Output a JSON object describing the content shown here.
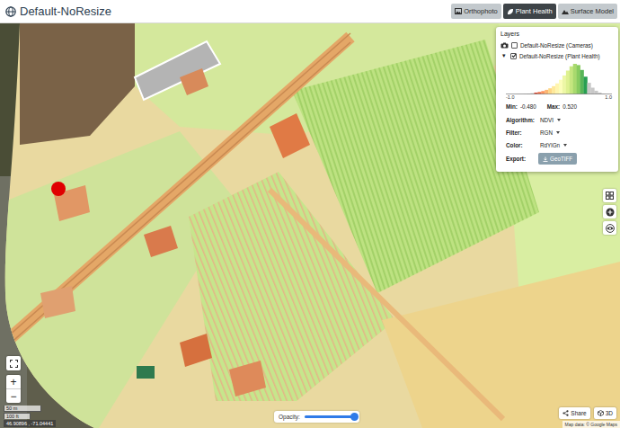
{
  "window": {
    "title": "Default-NoResize"
  },
  "view_tabs": [
    {
      "label": "Orthophoto",
      "selected": false,
      "kind": "image"
    },
    {
      "label": "Plant Health",
      "selected": true,
      "kind": "leaf"
    },
    {
      "label": "Surface Model",
      "selected": false,
      "kind": "terrain"
    }
  ],
  "layers_panel": {
    "title": "Layers",
    "layers": [
      {
        "kind": "cameras",
        "label": "Default-NoResize (Cameras)",
        "checked": false,
        "expanded": false
      },
      {
        "kind": "raster",
        "toggle": "▾",
        "label": "Default-NoResize (Plant Health)",
        "checked": true,
        "expanded": true,
        "details": {
          "histogram": {
            "axis_min": "-1.0",
            "axis_max": "1.0",
            "values": [
              0,
              0,
              0,
              1,
              1,
              2,
              3,
              4,
              6,
              8,
              11,
              15,
              20,
              27,
              36,
              48,
              62,
              78,
              92,
              100,
              96,
              80,
              58,
              38,
              22,
              12,
              6,
              3,
              1,
              0
            ]
          },
          "min_label": "Min:",
          "min": "-0.480",
          "max_label": "Max:",
          "max": "0.520",
          "fields": [
            {
              "label": "Algorithm:",
              "value": "NDVI"
            },
            {
              "label": "Filter:",
              "value": "RGN"
            },
            {
              "label": "Color:",
              "value": "RdYlGn"
            }
          ],
          "export": {
            "label": "Export:",
            "button": "GeoTIFF"
          }
        }
      }
    ]
  },
  "zoom": {
    "in": "+",
    "out": "−"
  },
  "scale": {
    "metric": "50 m",
    "imperial": "100 ft"
  },
  "coordinates": "46.90896 , -71.04441",
  "opacity": {
    "label": "Opacity:",
    "level": 1.0
  },
  "buttons": [
    {
      "label": "Share",
      "kind": "share"
    },
    {
      "label": "3D",
      "kind": "cube"
    }
  ],
  "attribution": "Map data: © Google Maps"
}
